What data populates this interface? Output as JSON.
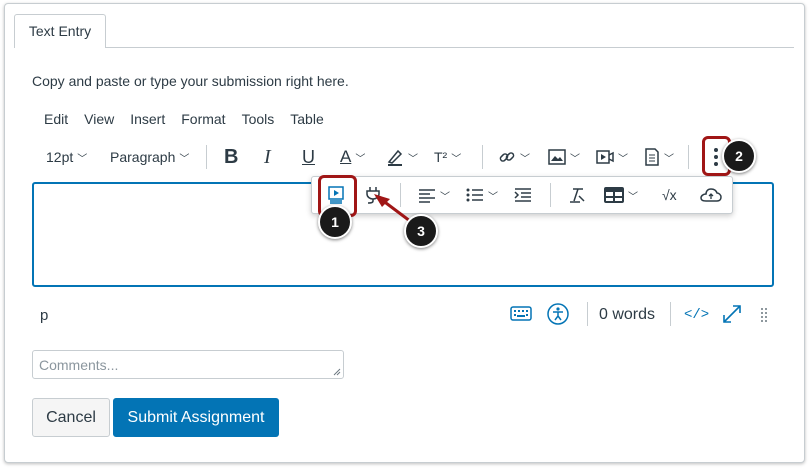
{
  "tab": {
    "label": "Text Entry"
  },
  "instructions": "Copy and paste or type your submission right here.",
  "menubar": [
    "Edit",
    "View",
    "Insert",
    "Format",
    "Tools",
    "Table"
  ],
  "toolbar": {
    "font_size": "12pt",
    "block_format": "Paragraph",
    "bold": "B",
    "italic": "I",
    "underline": "U",
    "text_color": "A",
    "superscript": "T²"
  },
  "popup_toolbar": {
    "math": "√x"
  },
  "callouts": [
    "1",
    "2",
    "3"
  ],
  "statusbar": {
    "element_path": "p",
    "word_count": "0 words",
    "html_editor": "</>"
  },
  "comments": {
    "placeholder": "Comments..."
  },
  "buttons": {
    "cancel": "Cancel",
    "submit": "Submit Assignment"
  },
  "colors": {
    "accent": "#0374b5",
    "highlight": "#a01616"
  }
}
